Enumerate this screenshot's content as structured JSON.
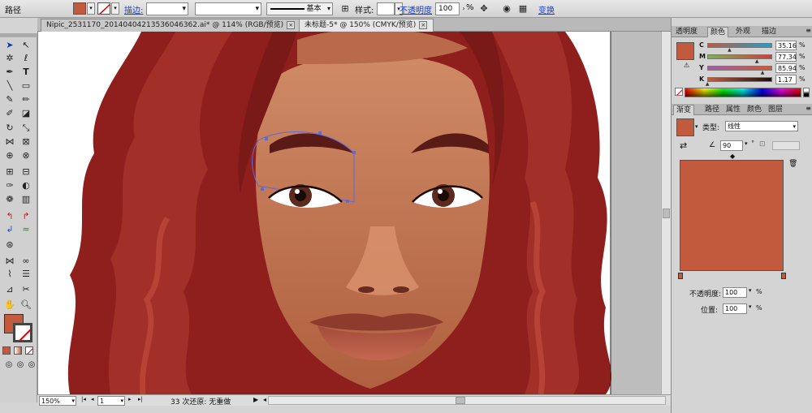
{
  "control_bar": {
    "label": "路径",
    "stroke_link": "描边:",
    "stroke_weight": "",
    "brush_profile": "",
    "brush_name": "基本",
    "style_label": "样式:",
    "opacity_link": "不透明度",
    "opacity_value": "100",
    "opacity_unit": "%",
    "transform_link": "变换"
  },
  "doc_tabs": [
    {
      "title": "Nipic_2531170_20140404213536046362.ai* @ 114% (RGB/预览)"
    },
    {
      "title": "未标题-5* @ 150% (CMYK/预览)"
    }
  ],
  "status": {
    "zoom": "150%",
    "page": "1",
    "message": "33 次还原: 无重做"
  },
  "color_panel": {
    "tabs": [
      "透明度",
      "颜色",
      "外观",
      "描边"
    ],
    "active_tab": "颜色",
    "swatch_color": "#c25a3d",
    "channels": [
      {
        "name": "C",
        "value": "35.16",
        "unit": "%",
        "fraction": 0.3516
      },
      {
        "name": "M",
        "value": "77.34",
        "unit": "%",
        "fraction": 0.7734
      },
      {
        "name": "Y",
        "value": "85.94",
        "unit": "%",
        "fraction": 0.8594
      },
      {
        "name": "K",
        "value": "1.17",
        "unit": "%",
        "fraction": 0.0117
      }
    ]
  },
  "gradient_panel": {
    "tabs": [
      "渐变",
      "路径",
      "属性",
      "颜色",
      "图层"
    ],
    "active_tab": "渐变",
    "type_label": "类型:",
    "type_value": "线性",
    "angle": "90",
    "angle_unit": "°",
    "preview_color": "#c25a3d",
    "opacity_label": "不透明度:",
    "opacity_value": "100",
    "opacity_unit": "%",
    "position_label": "位置:",
    "position_value": "100",
    "position_unit": "%"
  },
  "colors": {
    "fill": "#c25a3d",
    "hair": "#8f1f1c",
    "skin": "#b86a4a",
    "path_highlight": "#5b6bd8"
  }
}
